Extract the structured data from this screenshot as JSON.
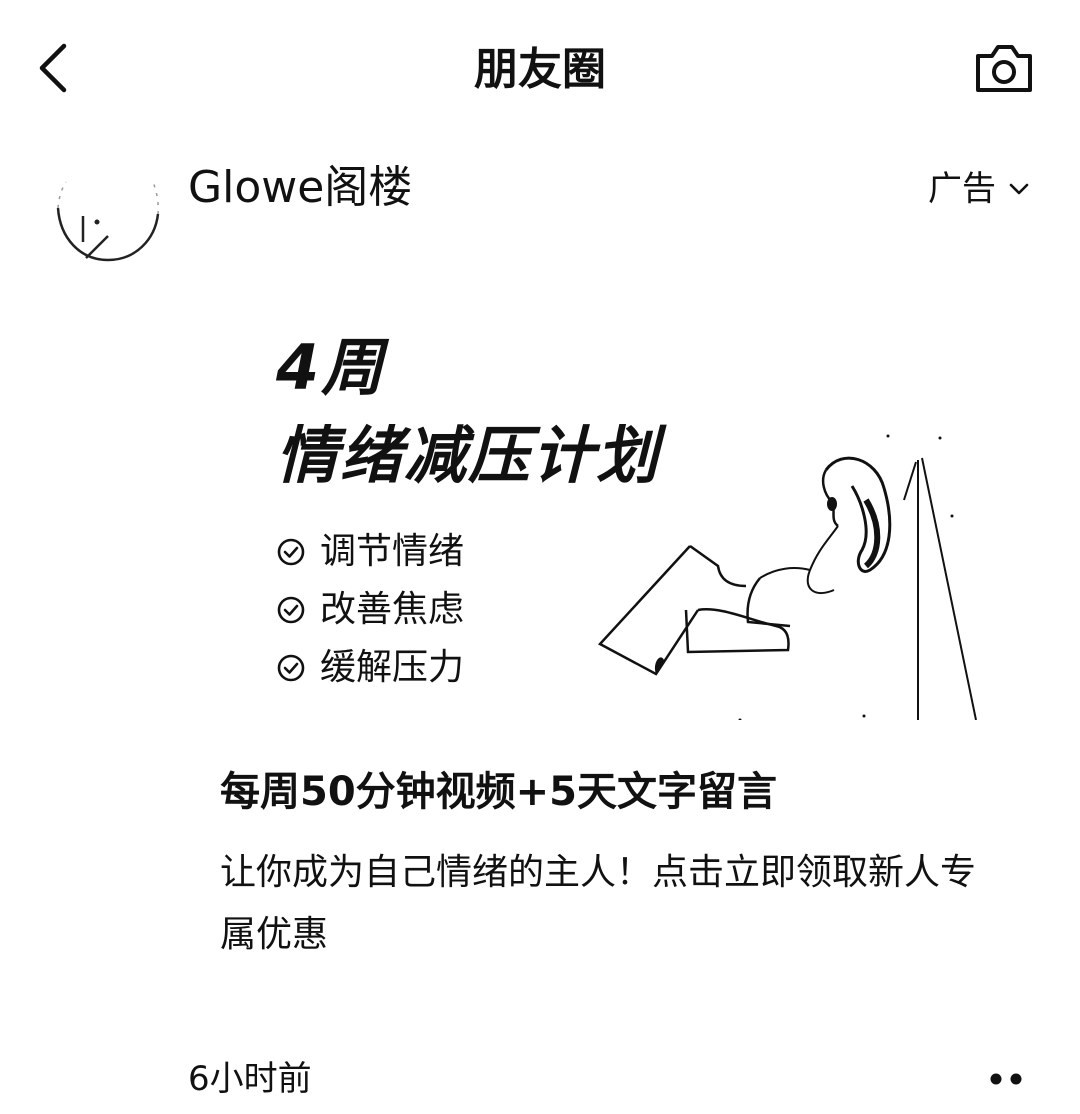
{
  "navbar": {
    "title": "朋友圈"
  },
  "post": {
    "poster_name": "Glowe阁楼",
    "ad_label": "广告",
    "banner": {
      "title_line1": "4周",
      "title_line2": "情绪减压计划",
      "checklist": [
        "调节情绪",
        "改善焦虑",
        "缓解压力"
      ]
    },
    "headline": "每周50分钟视频+5天文字留言",
    "body": "让你成为自己情绪的主人！点击立即领取新人专属优惠",
    "timestamp": "6小时前"
  },
  "icons": {
    "back": "chevron-left-icon",
    "camera": "camera-icon",
    "ad_menu": "chevron-down-icon",
    "check": "check-circle-icon",
    "more": "more-dots-icon"
  },
  "colors": {
    "background": "#ffffff",
    "text": "#111111"
  }
}
